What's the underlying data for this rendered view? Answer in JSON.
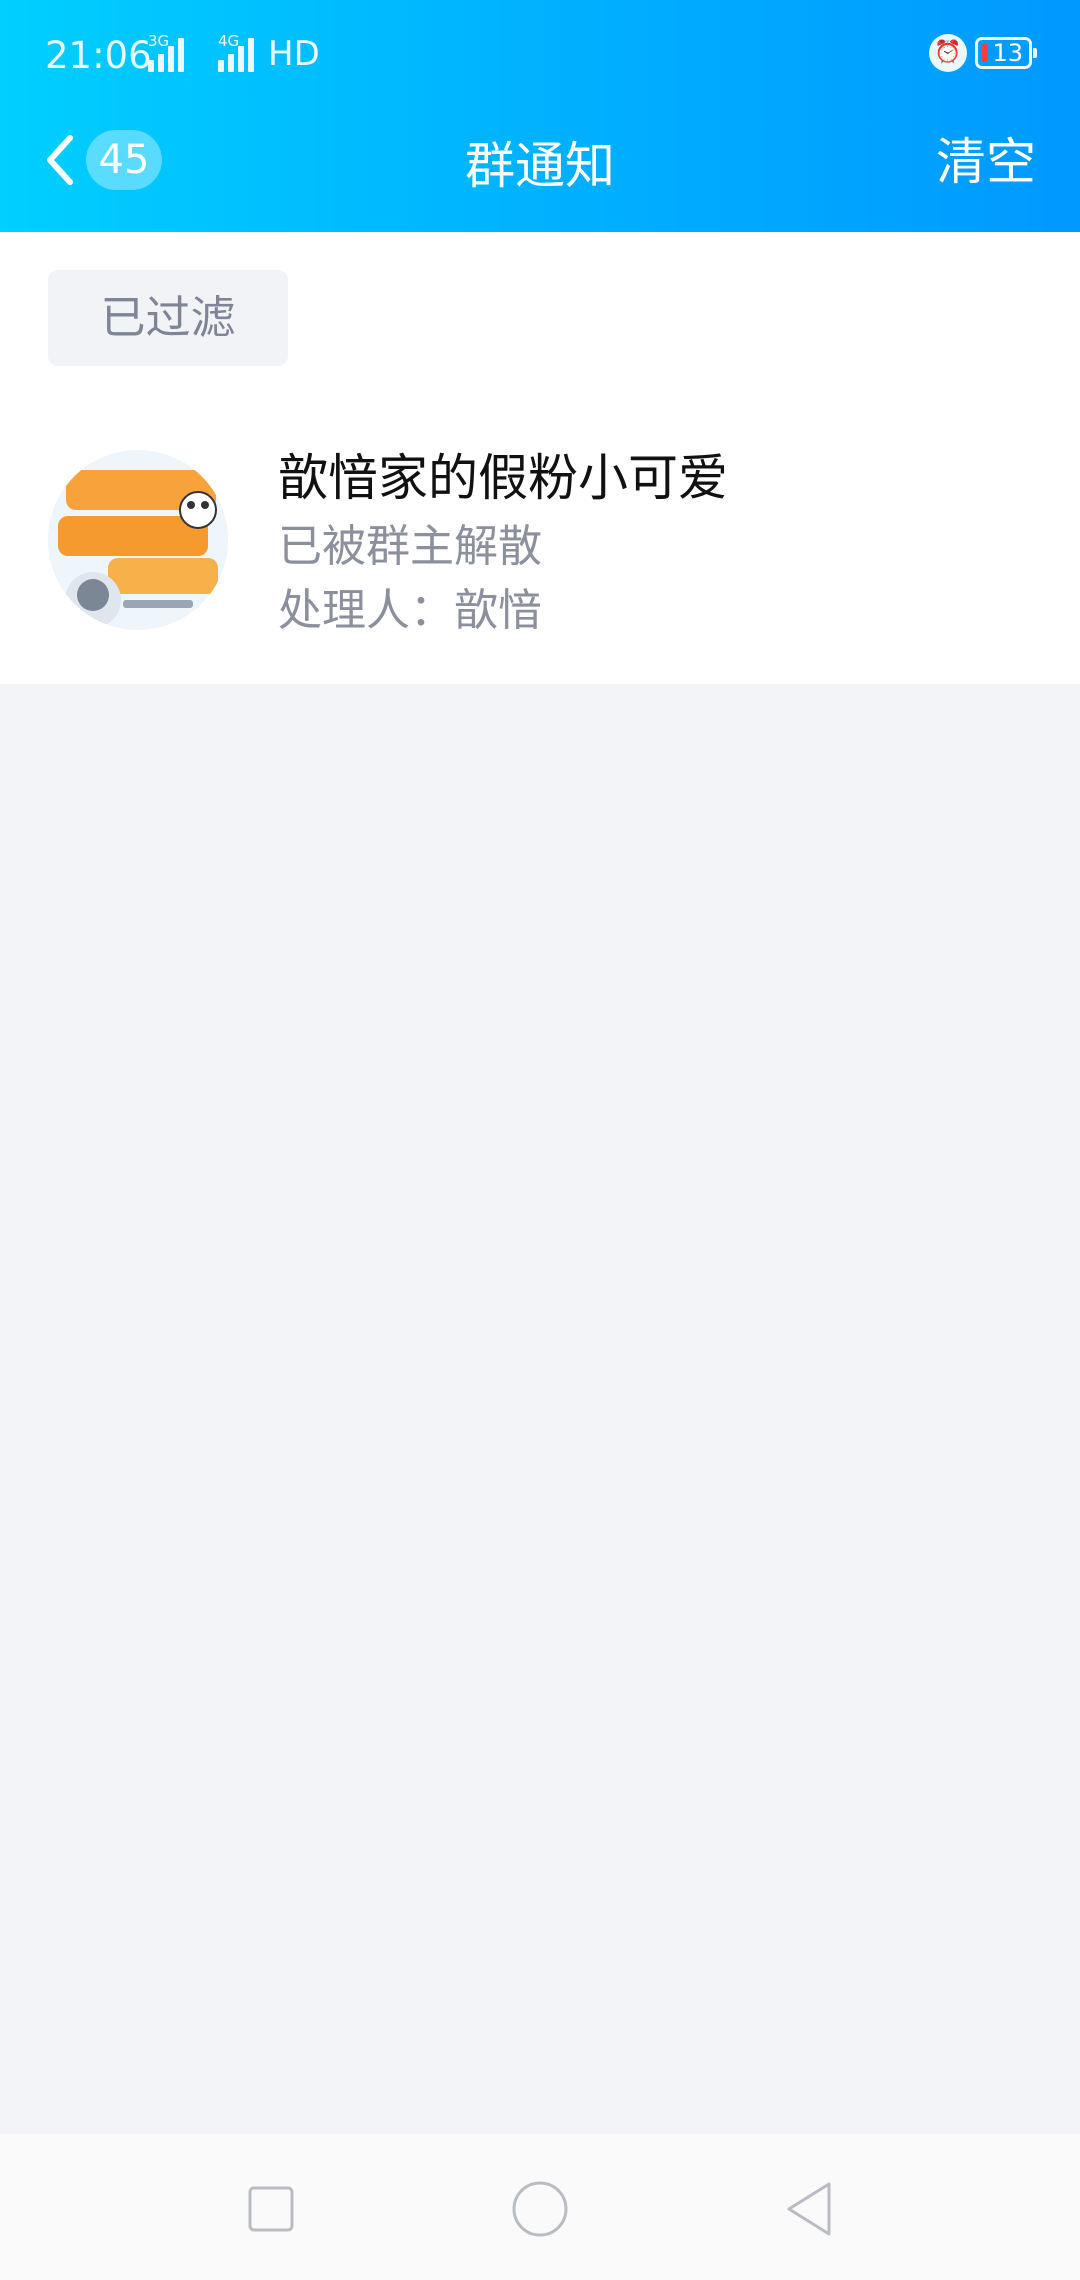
{
  "status_bar": {
    "time": "21:06",
    "signal1_label": "3G",
    "signal2_label": "4G",
    "hd_label": "HD",
    "battery_level": "13",
    "icons": [
      "alarm-icon",
      "battery-icon"
    ]
  },
  "header": {
    "back_count": "45",
    "title": "群通知",
    "clear_label": "清空"
  },
  "filter": {
    "label": "已过滤"
  },
  "notices": [
    {
      "group_name": "歆愔家的假粉小可爱",
      "status": "已被群主解散",
      "handler": "处理人：歆愔"
    }
  ],
  "colors": {
    "header_start": "#00cfff",
    "header_end": "#0099ff",
    "page_bg": "#f3f4f8",
    "secondary_text": "#8c909c"
  },
  "nav_icons": [
    "square-icon",
    "circle-icon",
    "triangle-back-icon"
  ]
}
